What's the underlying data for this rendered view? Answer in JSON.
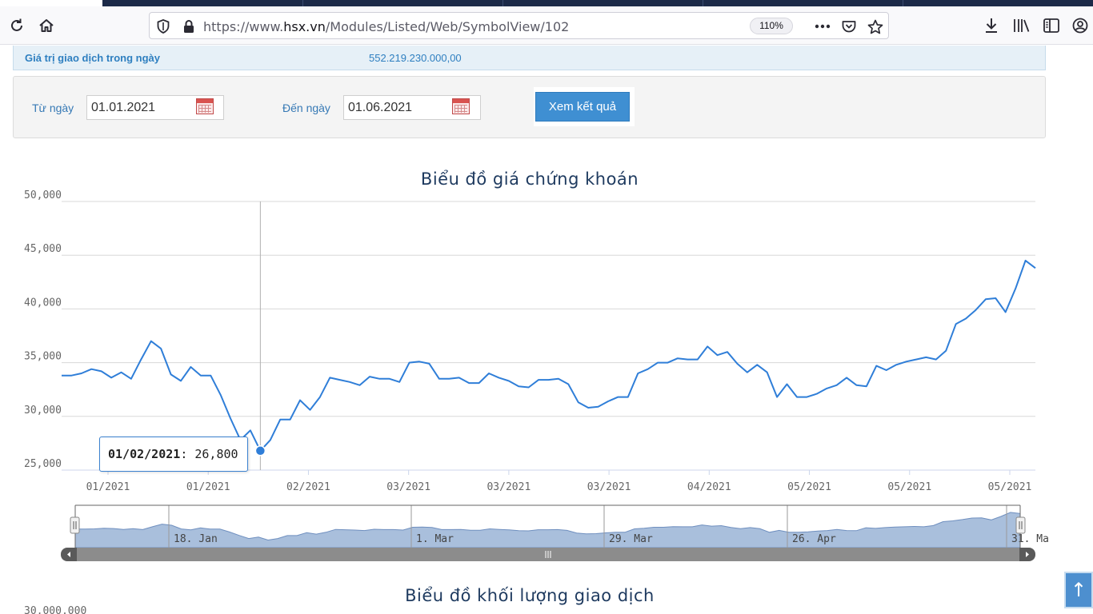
{
  "browser": {
    "url_prefix": "https://www.",
    "url_domain": "hsx.vn",
    "url_path": "/Modules/Listed/Web/SymbolView/102",
    "zoom": "110%",
    "icons": {
      "reload": "reload-icon",
      "home": "home-icon",
      "shield": "tracking-shield-icon",
      "lock": "lock-icon",
      "more": "more-actions-icon",
      "pocket": "pocket-icon",
      "bookmark": "bookmark-star-icon",
      "download": "download-icon",
      "library": "library-icon",
      "sidebar": "sidebar-icon",
      "account": "account-icon"
    }
  },
  "summary": {
    "label": "Giá trị giao dịch trong ngày",
    "value": "552.219.230.000,00"
  },
  "filter": {
    "from_label": "Từ ngày",
    "from_value": "01.01.2021",
    "to_label": "Đến ngày",
    "to_value": "01.06.2021",
    "submit_label": "Xem kết quả"
  },
  "tooltip": {
    "date": "01/02/2021",
    "separator": ":",
    "value": "26,800"
  },
  "volume_chart": {
    "title": "Biểu đồ khối lượng giao dịch",
    "first_ytick": "30,000,000"
  },
  "colors": {
    "line": "#2f7ed8",
    "navigator_fill": "#a9bfdc",
    "accent": "#3f8fd2"
  },
  "chart_data": {
    "type": "line",
    "title": "Biểu đồ giá chứng khoán",
    "ylim": [
      25000,
      50000
    ],
    "yticks": [
      "25,000",
      "30,000",
      "35,000",
      "40,000",
      "45,000",
      "50,000"
    ],
    "xtick_labels": [
      "01/2021",
      "01/2021",
      "02/2021",
      "03/2021",
      "03/2021",
      "03/2021",
      "04/2021",
      "05/2021",
      "05/2021",
      "05/2021"
    ],
    "navigator_labels": [
      "18. Jan",
      "1. Mar",
      "29. Mar",
      "26. Apr",
      "31. Ma"
    ],
    "grid": true,
    "series": [
      {
        "values": [
          33800,
          33800,
          34000,
          34400,
          34200,
          33600,
          34100,
          33500,
          35300,
          37000,
          36300,
          33900,
          33300,
          34600,
          33800,
          33800,
          32000,
          29800,
          27800,
          28700,
          26800,
          27800,
          29700,
          29700,
          31500,
          30600,
          31800,
          33600,
          33400,
          33200,
          32900,
          33700,
          33500,
          33500,
          33200,
          35000,
          35100,
          34900,
          33500,
          33500,
          33600,
          33100,
          33100,
          34000,
          33600,
          33300,
          32800,
          32700,
          33400,
          33400,
          33500,
          33000,
          31300,
          30800,
          30900,
          31400,
          31800,
          31800,
          34000,
          34400,
          35000,
          35000,
          35400,
          35300,
          35300,
          36500,
          35700,
          36000,
          34900,
          34100,
          34800,
          34100,
          31800,
          33000,
          31800,
          31800,
          32100,
          32600,
          32900,
          33600,
          32900,
          32800,
          34700,
          34300,
          34800,
          35100,
          35300,
          35500,
          35300,
          36100,
          38600,
          39100,
          39900,
          40900,
          41000,
          39700,
          41900,
          44500,
          43800
        ]
      }
    ]
  }
}
